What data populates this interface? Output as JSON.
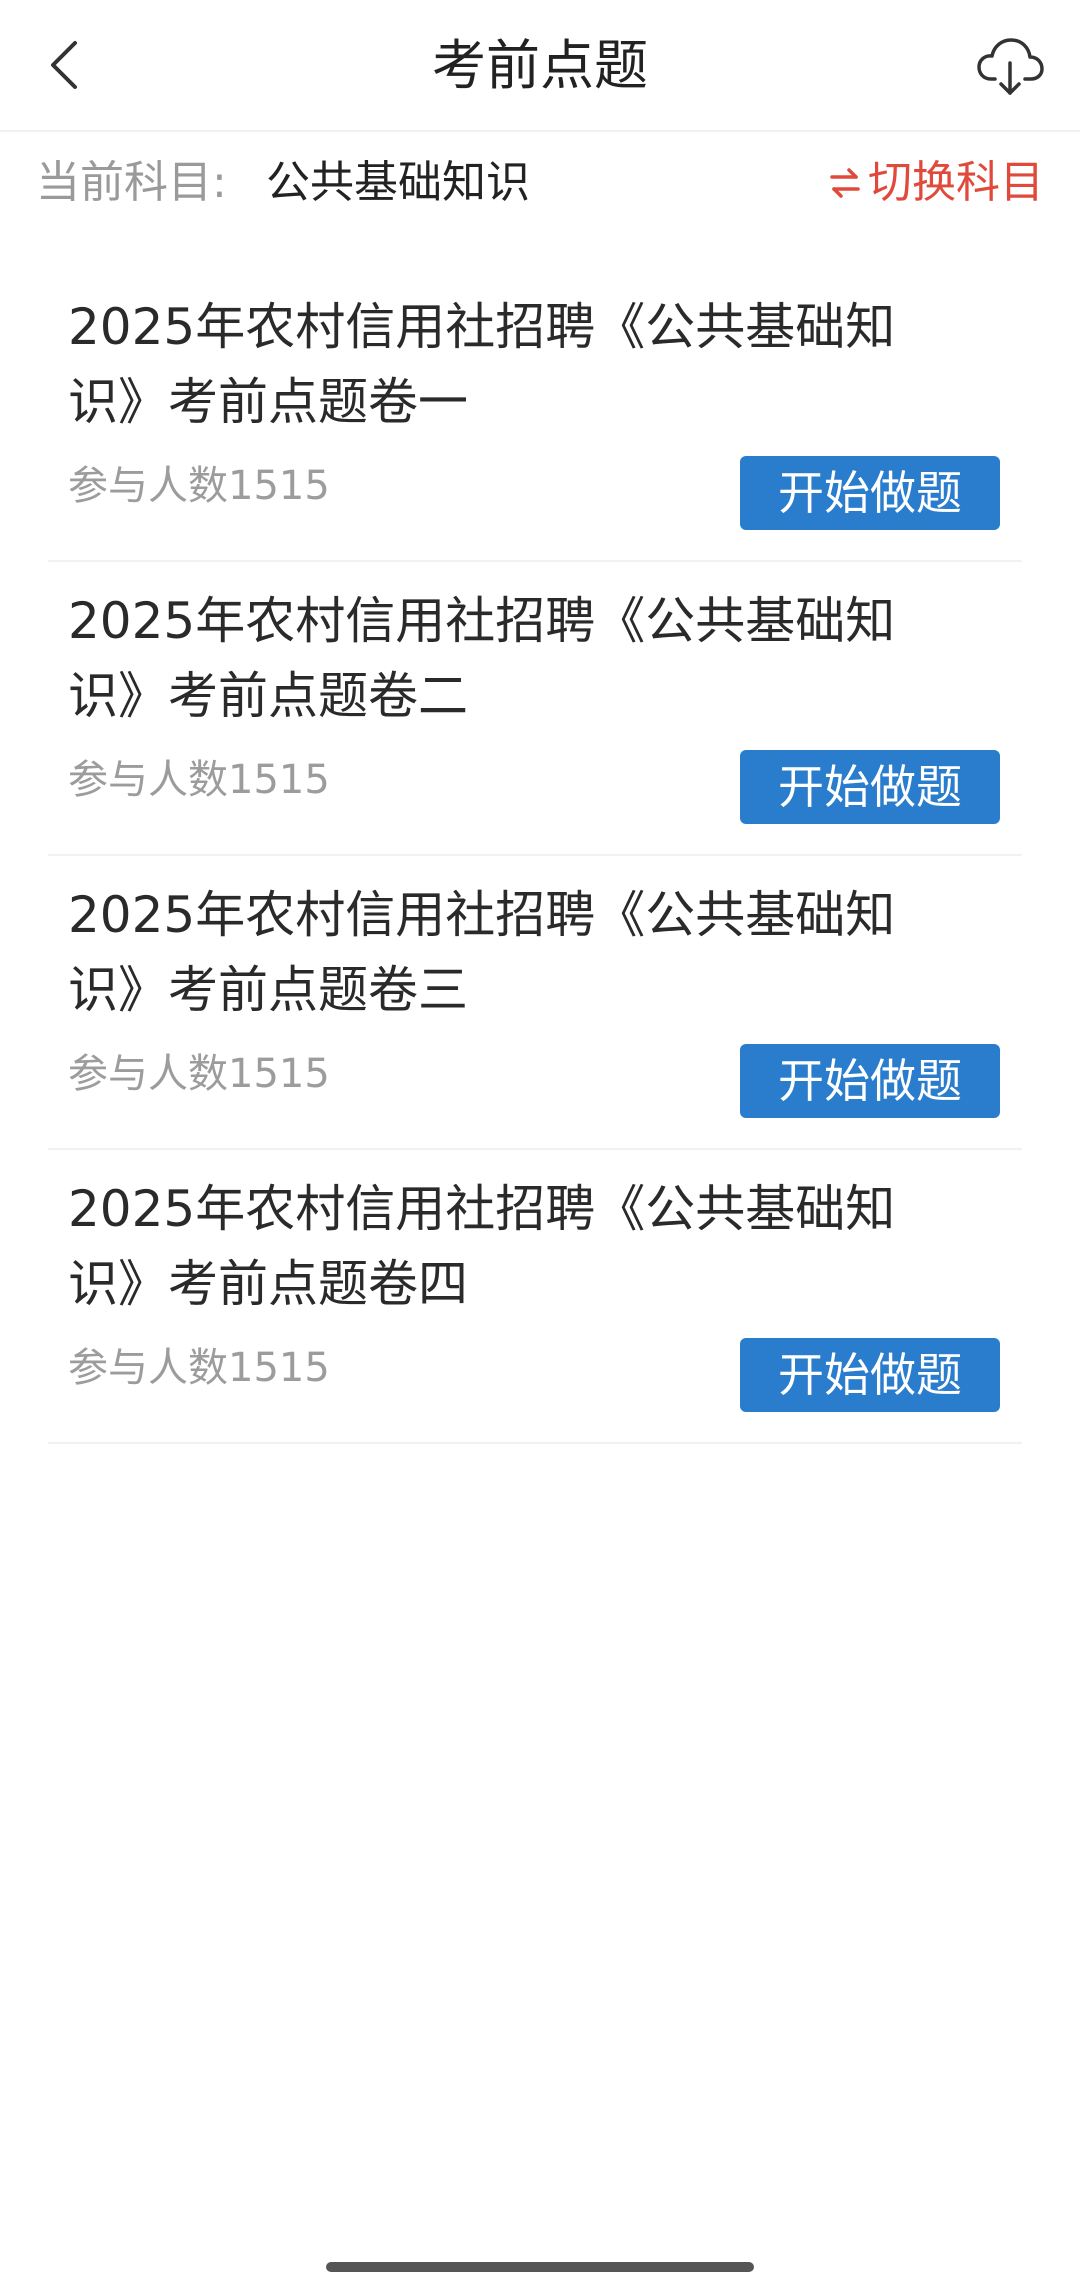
{
  "header": {
    "title": "考前点题",
    "back_icon": "chevron-left-icon",
    "download_icon": "cloud-download-icon"
  },
  "subject": {
    "label": "当前科目:",
    "value": "公共基础知识",
    "switch_label": "切换科目",
    "switch_icon": "swap-icon",
    "switch_color": "#e04a3c"
  },
  "papers": [
    {
      "title": "2025年农村信用社招聘《公共基础知识》考前点题卷一",
      "count": "参与人数1515",
      "button": "开始做题"
    },
    {
      "title": "2025年农村信用社招聘《公共基础知识》考前点题卷二",
      "count": "参与人数1515",
      "button": "开始做题"
    },
    {
      "title": "2025年农村信用社招聘《公共基础知识》考前点题卷三",
      "count": "参与人数1515",
      "button": "开始做题"
    },
    {
      "title": "2025年农村信用社招聘《公共基础知识》考前点题卷四",
      "count": "参与人数1515",
      "button": "开始做题"
    }
  ],
  "colors": {
    "primary_button": "#2a7dcc",
    "accent_red": "#e04a3c",
    "muted_text": "#9a9a9a"
  }
}
